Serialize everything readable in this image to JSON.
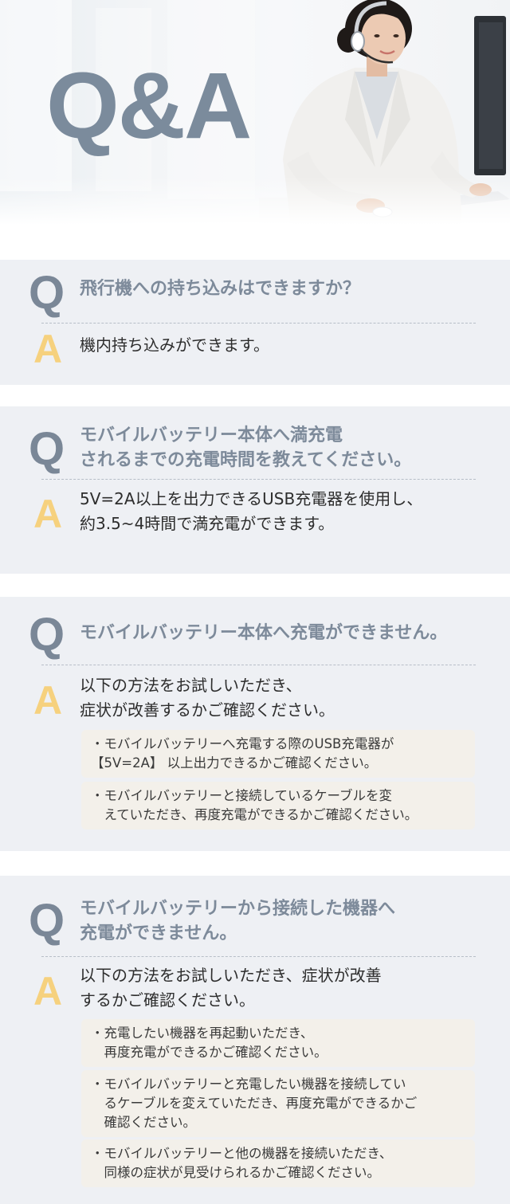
{
  "hero": {
    "title": "Q&A"
  },
  "colors": {
    "card_bg": "#eef0f4",
    "q_accent": "#7a8797",
    "a_accent": "#f6d17e",
    "note_bg": "#f3f0ea"
  },
  "faq": [
    {
      "q_mark": "Q",
      "a_mark": "A",
      "question": [
        "飛行機への持ち込みはできますか？"
      ],
      "answer": [
        "機内持ち込みができます。"
      ],
      "notes": []
    },
    {
      "q_mark": "Q",
      "a_mark": "A",
      "question": [
        "モバイルバッテリー本体へ満充電",
        "されるまでの充電時間を教えてください。"
      ],
      "answer": [
        "5V=2A以上を出力できるUSB充電器を使用し、",
        "約3.5~4時間で満充電ができます。"
      ],
      "notes": []
    },
    {
      "q_mark": "Q",
      "a_mark": "A",
      "question": [
        "モバイルバッテリー本体へ充電ができません。"
      ],
      "answer": [
        "以下の方法をお試しいただき、",
        "症状が改善するかご確認ください。"
      ],
      "notes": [
        [
          "・モバイルバッテリーへ充電する際のUSB充電器が",
          "【5V=2A】 以上出力できるかご確認ください。"
        ],
        [
          "・モバイルバッテリーと接続しているケーブルを変",
          "　えていただき、再度充電ができるかご確認ください。"
        ]
      ]
    },
    {
      "q_mark": "Q",
      "a_mark": "A",
      "question": [
        "モバイルバッテリーから接続した機器へ",
        "充電ができません。"
      ],
      "answer": [
        "以下の方法をお試しいただき、症状が改善",
        "するかご確認ください。"
      ],
      "notes": [
        [
          "・充電したい機器を再起動いただき、",
          "　再度充電ができるかご確認ください。"
        ],
        [
          "・モバイルバッテリーと充電したい機器を接続してい",
          "　るケーブルを変えていただき、再度充電ができるかご",
          "　確認ください。"
        ],
        [
          "・モバイルバッテリーと他の機器を接続いただき、",
          "　同様の症状が見受けられるかご確認ください。"
        ]
      ]
    }
  ]
}
